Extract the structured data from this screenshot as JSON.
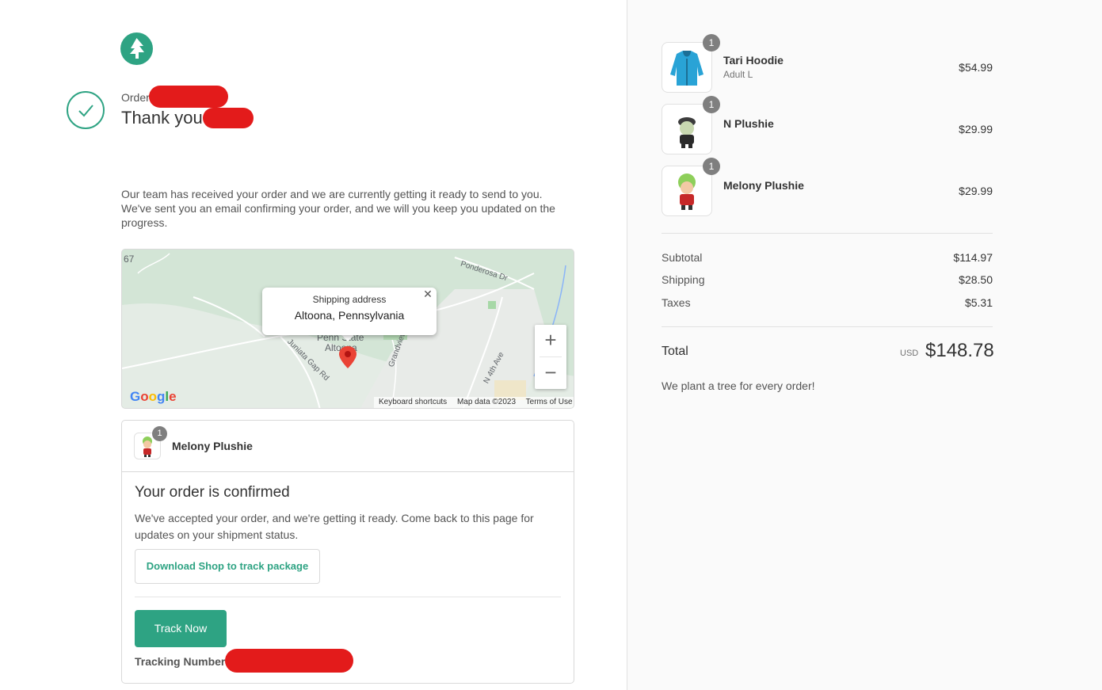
{
  "header": {
    "order_label": "Order",
    "thank_you": "Thank you"
  },
  "message": "Our team has received your order and we are currently getting it ready to send to you. We've sent you an email confirming your order, and we will you keep you updated on the progress.",
  "map": {
    "popup_label": "Shipping address",
    "popup_value": "Altoona, Pennsylvania",
    "zoom_in": "+",
    "zoom_out": "−",
    "labels": {
      "road_67": "67",
      "ponderosa": "Ponderosa Dr",
      "penn_state": "Penn State",
      "altoona": "Altoona",
      "juniata": "Juniata Gap Rd",
      "grandview": "Grandview",
      "n4th": "N 4th Ave"
    },
    "google": "Google",
    "keyboard": "Keyboard shortcuts",
    "map_data": "Map data ©2023",
    "terms": "Terms of Use"
  },
  "card": {
    "item_name": "Melony Plushie",
    "item_qty": "1",
    "title": "Your order is confirmed",
    "message": "We've accepted your order, and we're getting it ready. Come back to this page for updates on your shipment status.",
    "download_button": "Download Shop to track package",
    "track_button": "Track Now",
    "tracking_label": "Tracking Number:"
  },
  "summary": {
    "items": [
      {
        "name": "Tari Hoodie",
        "variant": "Adult L",
        "qty": "1",
        "price": "$54.99"
      },
      {
        "name": "N Plushie",
        "variant": "",
        "qty": "1",
        "price": "$29.99"
      },
      {
        "name": "Melony Plushie",
        "variant": "",
        "qty": "1",
        "price": "$29.99"
      }
    ],
    "subtotal_label": "Subtotal",
    "subtotal": "$114.97",
    "shipping_label": "Shipping",
    "shipping": "$28.50",
    "taxes_label": "Taxes",
    "taxes": "$5.31",
    "total_label": "Total",
    "currency": "USD",
    "total": "$148.78",
    "tree_note": "We plant a tree for every order!"
  },
  "colors": {
    "accent": "#2ea383",
    "redaction": "#e31b1b",
    "badge": "#7f7f7f"
  }
}
